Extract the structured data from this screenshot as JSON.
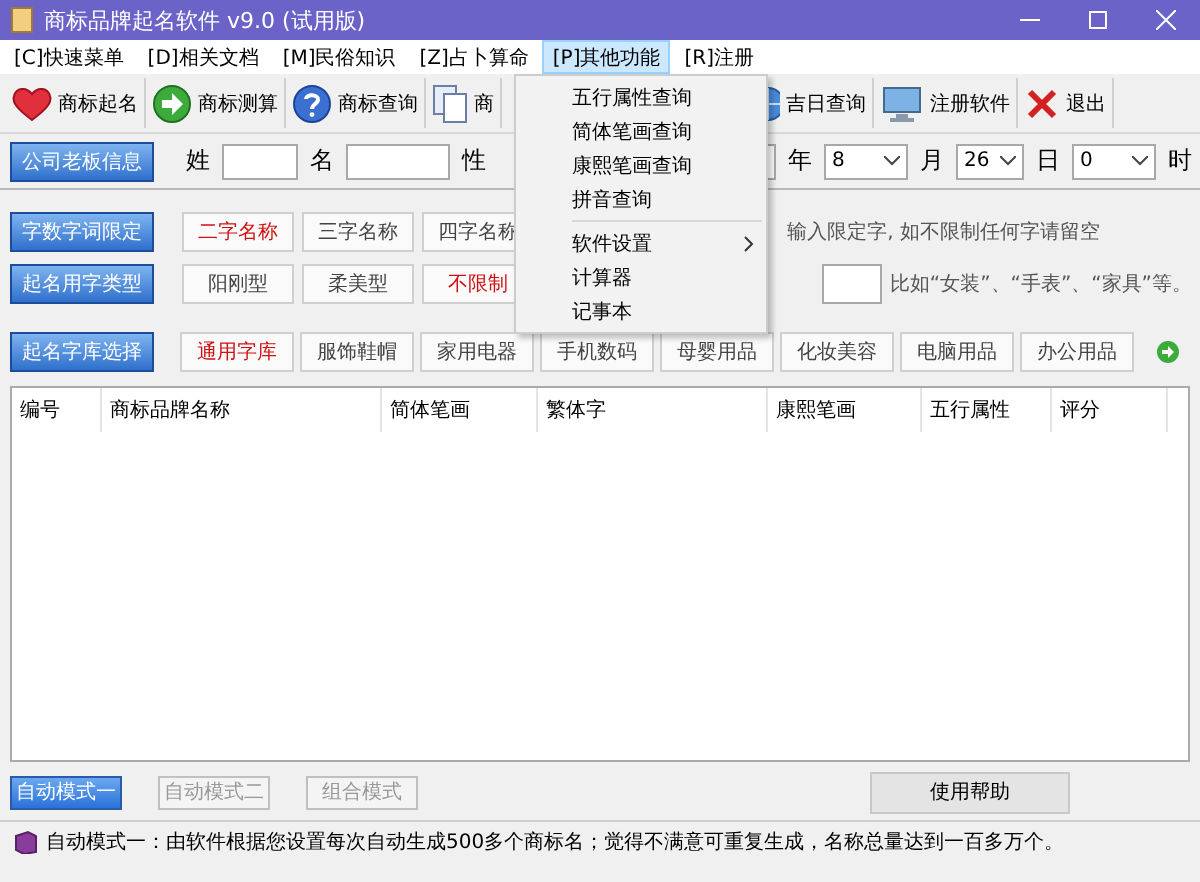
{
  "window": {
    "title": "商标品牌起名软件 v9.0 (试用版)"
  },
  "menu": [
    {
      "label": "[C]快速菜单",
      "selected": false
    },
    {
      "label": "[D]相关文档",
      "selected": false
    },
    {
      "label": "[M]民俗知识",
      "selected": false
    },
    {
      "label": "[Z]占卜算命",
      "selected": false
    },
    {
      "label": "[P]其他功能",
      "selected": true
    },
    {
      "label": "[R]注册",
      "selected": false
    }
  ],
  "dropdown": [
    {
      "kind": "item",
      "label": "五行属性查询"
    },
    {
      "kind": "item",
      "label": "简体笔画查询"
    },
    {
      "kind": "item",
      "label": "康熙笔画查询"
    },
    {
      "kind": "item",
      "label": "拼音查询"
    },
    {
      "kind": "separator"
    },
    {
      "kind": "submenu",
      "label": "软件设置"
    },
    {
      "kind": "item",
      "label": "计算器"
    },
    {
      "kind": "item",
      "label": "记事本"
    }
  ],
  "toolbar": [
    "商标起名",
    "商标测算",
    "商标查询",
    "商",
    "吉日查询",
    "注册软件",
    "退出"
  ],
  "owner": {
    "button": "公司老板信息",
    "surname_label": "姓",
    "given_label": "名",
    "gender_label": "性",
    "year_label": "年",
    "month": "8",
    "month_label": "月",
    "day": "26",
    "day_label": "日",
    "hour": "0",
    "hour_label": "时"
  },
  "word_count": {
    "button": "字数字词限定",
    "options": [
      {
        "label": "二字名称",
        "selected": true
      },
      {
        "label": "三字名称",
        "selected": false
      },
      {
        "label": "四字名称",
        "selected": false
      }
    ],
    "hint": "输入限定字, 如不限制任何字请留空"
  },
  "word_type": {
    "button": "起名用字类型",
    "options": [
      {
        "label": "阳刚型",
        "selected": false
      },
      {
        "label": "柔美型",
        "selected": false
      },
      {
        "label": "不限制",
        "selected": true
      }
    ],
    "hint": "比如“女装”、“手表”、“家具”等。"
  },
  "library": {
    "button": "起名字库选择",
    "options": [
      {
        "label": "通用字库",
        "selected": true
      },
      {
        "label": "服饰鞋帽",
        "selected": false
      },
      {
        "label": "家用电器",
        "selected": false
      },
      {
        "label": "手机数码",
        "selected": false
      },
      {
        "label": "母婴用品",
        "selected": false
      },
      {
        "label": "化妆美容",
        "selected": false
      },
      {
        "label": "电脑用品",
        "selected": false
      },
      {
        "label": "办公用品",
        "selected": false
      }
    ]
  },
  "table": {
    "columns": [
      "编号",
      "商标品牌名称",
      "简体笔画",
      "繁体字",
      "康熙笔画",
      "五行属性",
      "评分"
    ]
  },
  "modes": [
    {
      "label": "自动模式一",
      "selected": true
    },
    {
      "label": "自动模式二",
      "selected": false
    },
    {
      "label": "组合模式",
      "selected": false
    }
  ],
  "help_button": "使用帮助",
  "status": "自动模式一：由软件根据您设置每次自动生成500多个商标名；觉得不满意可重复生成，名称总量达到一百多万个。"
}
